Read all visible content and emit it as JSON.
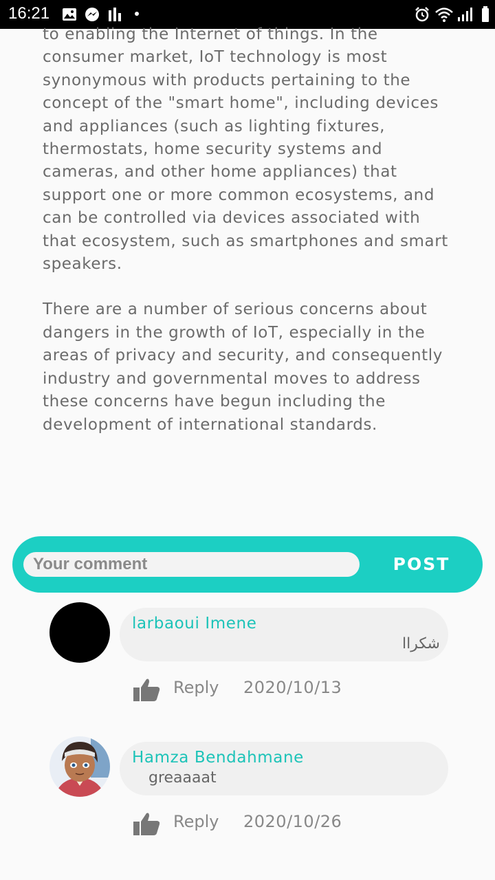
{
  "status_bar": {
    "time": "16:21",
    "icons": [
      "gallery-icon",
      "messenger-icon",
      "data-icon",
      "dot-icon",
      "alarm-icon",
      "wifi-icon",
      "signal-icon",
      "battery-icon"
    ]
  },
  "article": {
    "paragraphs": [
      "to enabling the Internet of things. In the consumer market, IoT technology is most synonymous with products pertaining to the concept of the \"smart home\", including devices and appliances (such as lighting fixtures, thermostats, home security systems and cameras, and other home appliances) that support one or more common ecosystems, and can be controlled via devices associated with that ecosystem, such as smartphones and smart speakers.",
      "There are a number of serious concerns about dangers in the growth of IoT, especially in the areas of privacy and security, and consequently industry and governmental moves to address these concerns have begun including the development of international standards."
    ]
  },
  "comment_form": {
    "placeholder": "Your comment",
    "post_label": "POST"
  },
  "colors": {
    "accent": "#1ccfc3",
    "author": "#1cc3b8"
  },
  "comments": [
    {
      "author": "larbaoui Imene",
      "text": "شكراا",
      "reply_label": "Reply",
      "date": "2020/10/13"
    },
    {
      "author": "Hamza Bendahmane",
      "text": "greaaaat",
      "reply_label": "Reply",
      "date": "2020/10/26"
    }
  ]
}
